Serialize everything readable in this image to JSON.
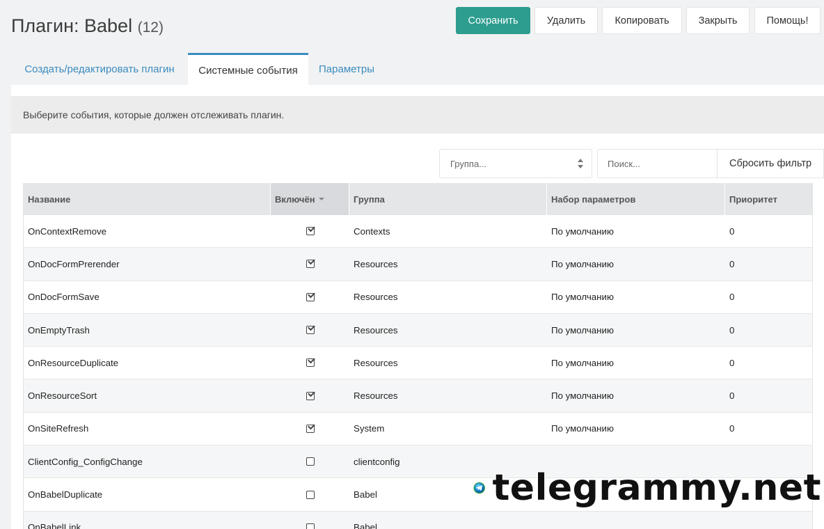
{
  "header": {
    "title": "Плагин: Babel",
    "count": "(12)"
  },
  "toolbar": {
    "save_label": "Сохранить",
    "delete_label": "Удалить",
    "copy_label": "Копировать",
    "close_label": "Закрыть",
    "help_label": "Помощь!"
  },
  "tabs": [
    {
      "label": "Создать/редактировать плагин",
      "active": false
    },
    {
      "label": "Системные события",
      "active": true
    },
    {
      "label": "Параметры",
      "active": false
    }
  ],
  "description": "Выберите события, которые должен отслеживать плагин.",
  "filters": {
    "group_placeholder": "Группа...",
    "search_placeholder": "Поиск...",
    "reset_label": "Сбросить фильтр"
  },
  "grid": {
    "columns": [
      "Название",
      "Включён",
      "Группа",
      "Набор параметров",
      "Приоритет"
    ],
    "rows": [
      {
        "name": "OnContextRemove",
        "enabled": true,
        "group": "Contexts",
        "propset": "По умолчанию",
        "priority": "0"
      },
      {
        "name": "OnDocFormPrerender",
        "enabled": true,
        "group": "Resources",
        "propset": "По умолчанию",
        "priority": "0"
      },
      {
        "name": "OnDocFormSave",
        "enabled": true,
        "group": "Resources",
        "propset": "По умолчанию",
        "priority": "0"
      },
      {
        "name": "OnEmptyTrash",
        "enabled": true,
        "group": "Resources",
        "propset": "По умолчанию",
        "priority": "0"
      },
      {
        "name": "OnResourceDuplicate",
        "enabled": true,
        "group": "Resources",
        "propset": "По умолчанию",
        "priority": "0"
      },
      {
        "name": "OnResourceSort",
        "enabled": true,
        "group": "Resources",
        "propset": "По умолчанию",
        "priority": "0"
      },
      {
        "name": "OnSiteRefresh",
        "enabled": true,
        "group": "System",
        "propset": "По умолчанию",
        "priority": "0"
      },
      {
        "name": "ClientConfig_ConfigChange",
        "enabled": false,
        "group": "clientconfig",
        "propset": "",
        "priority": ""
      },
      {
        "name": "OnBabelDuplicate",
        "enabled": false,
        "group": "Babel",
        "propset": "",
        "priority": ""
      },
      {
        "name": "OnBabelLink",
        "enabled": false,
        "group": "Babel",
        "propset": "",
        "priority": ""
      }
    ]
  },
  "watermark": {
    "text": "telegrammy.net"
  },
  "colors": {
    "primary": "#2d9d8f",
    "link": "#3b8bbe",
    "header_bg": "#e4e6e8"
  }
}
